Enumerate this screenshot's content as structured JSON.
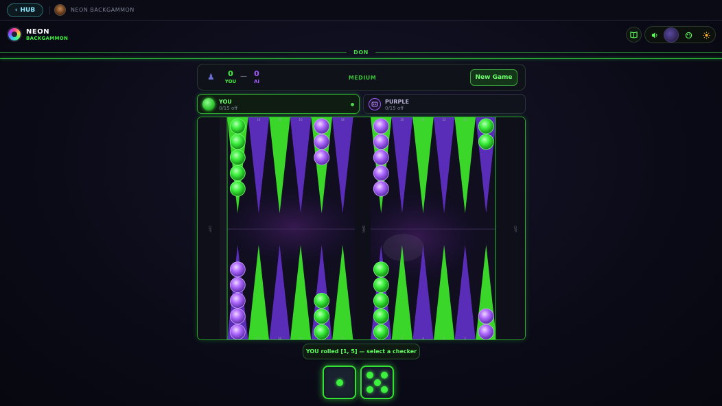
{
  "topbar": {
    "hub_label": "HUB",
    "title": "NEON BACKGAMMON"
  },
  "brand": {
    "title": "NEON",
    "subtitle": "BACKGAMMON"
  },
  "header_icons": [
    "book-icon",
    "sound-icon",
    "theme-orb-icon",
    "palette-icon",
    "sun-icon"
  ],
  "divider_label": "DON",
  "score": {
    "you_score": "0",
    "you_label": "YOU",
    "dash": "—",
    "ai_score": "0",
    "ai_label": "AI",
    "difficulty": "MEDIUM",
    "new_game_label": "New Game"
  },
  "players": {
    "you": {
      "name": "YOU",
      "off": "0/15 off"
    },
    "ai": {
      "name": "PURPLE",
      "off": "0/15 off"
    }
  },
  "board": {
    "off_label": "OFF",
    "bar_label": "BAR",
    "colors": {
      "green": "#3df03d",
      "purple": "#a35bff",
      "tri_green": "#3bd62a",
      "tri_purple": "#5a2db8"
    },
    "top_numbers": [
      "13",
      "14",
      "15",
      "16",
      "17",
      "18",
      "19",
      "20",
      "21",
      "22",
      "23",
      "24"
    ],
    "bottom_numbers": [
      "12",
      "11",
      "10",
      "9",
      "8",
      "7",
      "6",
      "5",
      "4",
      "3",
      "2",
      "1"
    ],
    "top_points": [
      {
        "color": "green",
        "count": 5
      },
      {
        "color": null,
        "count": 0
      },
      {
        "color": null,
        "count": 0
      },
      {
        "color": null,
        "count": 0
      },
      {
        "color": "purple",
        "count": 3
      },
      {
        "color": null,
        "count": 0
      },
      {
        "color": "purple",
        "count": 5
      },
      {
        "color": null,
        "count": 0
      },
      {
        "color": null,
        "count": 0
      },
      {
        "color": null,
        "count": 0
      },
      {
        "color": null,
        "count": 0
      },
      {
        "color": "green",
        "count": 2
      }
    ],
    "bottom_points": [
      {
        "color": "purple",
        "count": 5
      },
      {
        "color": null,
        "count": 0
      },
      {
        "color": null,
        "count": 0
      },
      {
        "color": null,
        "count": 0
      },
      {
        "color": "green",
        "count": 3
      },
      {
        "color": null,
        "count": 0
      },
      {
        "color": "green",
        "count": 5
      },
      {
        "color": null,
        "count": 0
      },
      {
        "color": null,
        "count": 0
      },
      {
        "color": null,
        "count": 0
      },
      {
        "color": null,
        "count": 0
      },
      {
        "color": "purple",
        "count": 2
      }
    ]
  },
  "status": "YOU rolled [1, 5] — select a checker",
  "dice": [
    1,
    5
  ]
}
